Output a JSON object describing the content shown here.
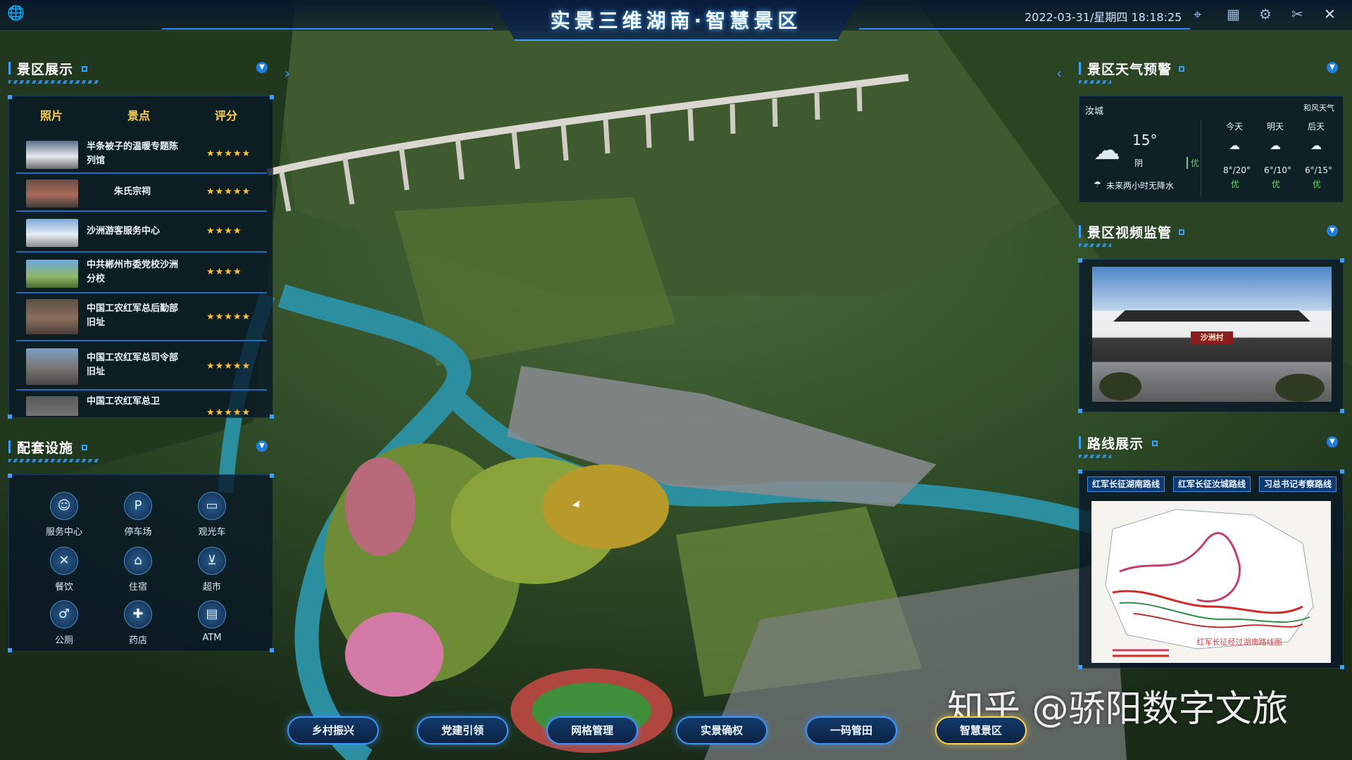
{
  "header": {
    "title": "实景三维湖南·智慧景区",
    "datetime": "2022-03-31/星期四 18:18:25"
  },
  "scenic_panel": {
    "title": "景区展示",
    "columns": [
      "照片",
      "景点",
      "评分"
    ],
    "rows": [
      {
        "name": "半条被子的温暖专题陈列馆",
        "rating": 5,
        "stars": "★★★★★"
      },
      {
        "name": "朱氏宗祠",
        "rating": 5,
        "stars": "★★★★★"
      },
      {
        "name": "沙洲游客服务中心",
        "rating": 4,
        "stars": "★★★★"
      },
      {
        "name": "中共郴州市委党校沙洲分校",
        "rating": 4,
        "stars": "★★★★"
      },
      {
        "name": "中国工农红军总后勤部旧址",
        "rating": 5,
        "stars": "★★★★★"
      },
      {
        "name": "中国工农红军总司令部旧址",
        "rating": 5,
        "stars": "★★★★★"
      },
      {
        "name": "中国工农红军总卫",
        "rating": 5,
        "stars": "★★★★★"
      }
    ]
  },
  "facilities_panel": {
    "title": "配套设施",
    "items": [
      {
        "label": "服务中心",
        "icon": "person-icon",
        "glyph": "☺"
      },
      {
        "label": "停车场",
        "icon": "parking-icon",
        "glyph": "P"
      },
      {
        "label": "观光车",
        "icon": "bus-icon",
        "glyph": "▭"
      },
      {
        "label": "餐饮",
        "icon": "utensils-icon",
        "glyph": "✕"
      },
      {
        "label": "住宿",
        "icon": "bed-icon",
        "glyph": "⌂"
      },
      {
        "label": "超市",
        "icon": "cart-icon",
        "glyph": "⊻"
      },
      {
        "label": "公厕",
        "icon": "restroom-icon",
        "glyph": "♂"
      },
      {
        "label": "药店",
        "icon": "pharmacy-icon",
        "glyph": "✚"
      },
      {
        "label": "ATM",
        "icon": "atm-icon",
        "glyph": "▤"
      }
    ]
  },
  "weather_panel": {
    "title": "景区天气预警",
    "city": "汝城",
    "temp": "15°",
    "condition": "阴",
    "aqi": "优",
    "rain_note": "未来两小时无降水",
    "source": "和风天气",
    "forecast": [
      {
        "day": "今天",
        "range": "8°/20°",
        "aqi": "优"
      },
      {
        "day": "明天",
        "range": "6°/10°",
        "aqi": "优"
      },
      {
        "day": "后天",
        "range": "6°/15°",
        "aqi": "优"
      }
    ]
  },
  "video_panel": {
    "title": "景区视频监管",
    "sign": "沙洲村"
  },
  "route_panel": {
    "title": "路线展示",
    "tabs": [
      "红军长征湖南路线",
      "红军长征汝城路线",
      "习总书记考察路线"
    ],
    "map_caption": "红军长征经过湖南路线图"
  },
  "bottom_nav": [
    "乡村振兴",
    "党建引领",
    "网格管理",
    "实景确权",
    "一码管田",
    "智慧景区"
  ],
  "watermark": "知乎 @骄阳数字文旅",
  "colors": {
    "accent": "#3aa0ff",
    "star": "#ffc233",
    "header_text": "#ffd34d"
  }
}
